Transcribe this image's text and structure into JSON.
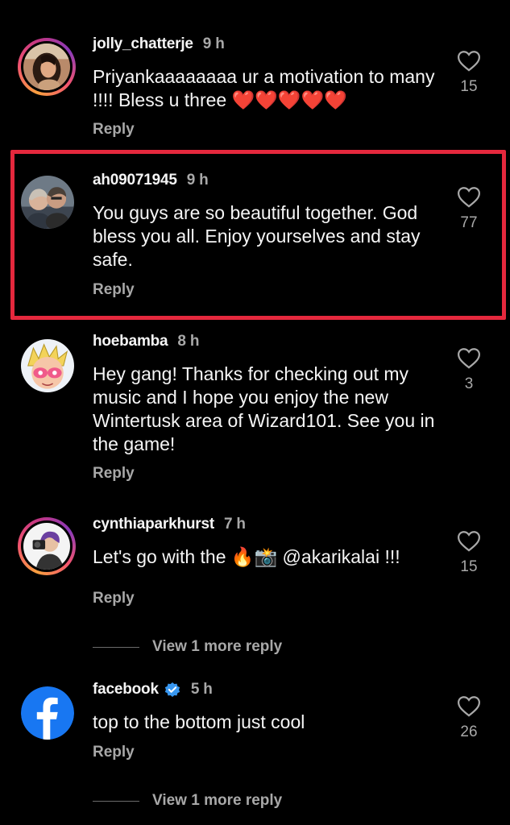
{
  "comments": [
    {
      "username": "jolly_chatterje",
      "time": "9 h",
      "text": "Priyankaaaaaaaa ur a motivation to many !!!! Bless u three ❤️❤️❤️❤️❤️",
      "reply_label": "Reply",
      "likes": "15",
      "avatar": "woman-portrait-avatar",
      "story_ring": true
    },
    {
      "username": "ah09071945",
      "time": "9 h",
      "text": "You guys are so beautiful together. God bless you all. Enjoy yourselves and stay safe.",
      "reply_label": "Reply",
      "likes": "77",
      "avatar": "couple-photo-avatar",
      "story_ring": false,
      "highlighted": true
    },
    {
      "username": "hoebamba",
      "time": "8 h",
      "text": "Hey gang! Thanks for checking out my music and I hope you enjoy the new Wintertusk area of Wizard101. See you in the game!",
      "reply_label": "Reply",
      "likes": "3",
      "avatar": "cartoon-character-avatar",
      "story_ring": false
    },
    {
      "username": "cynthiaparkhurst",
      "time": "7 h",
      "text": "Let's go with the 🔥📸 @akarikalai !!!",
      "reply_label": "Reply",
      "likes": "15",
      "avatar": "photographer-avatar",
      "story_ring": true,
      "view_more": "View 1 more reply"
    },
    {
      "username": "facebook",
      "time": "5 h",
      "text": "top to the bottom just cool",
      "reply_label": "Reply",
      "likes": "26",
      "avatar": "facebook-logo-avatar",
      "verified": true,
      "story_ring": false,
      "view_more": "View 1 more reply"
    }
  ],
  "colors": {
    "background": "#000000",
    "text": "#f5f5f5",
    "secondary_text": "#a8a8a8",
    "highlight_border": "#e5283d",
    "verified_blue": "#3897f0",
    "facebook_blue": "#1877f2"
  }
}
